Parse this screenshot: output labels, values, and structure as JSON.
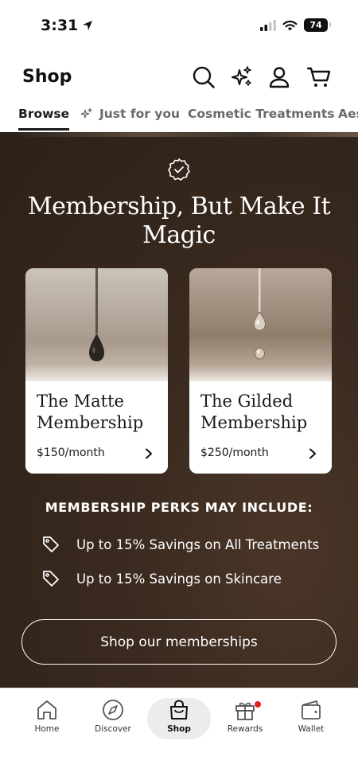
{
  "status_bar": {
    "time": "3:31",
    "battery": "74"
  },
  "header": {
    "title": "Shop",
    "icons": [
      "search-icon",
      "sparkles-icon",
      "profile-icon",
      "cart-icon"
    ]
  },
  "tabs": [
    {
      "label": "Browse",
      "active": true
    },
    {
      "label": "Just for you",
      "icon": "sparkle-icon"
    },
    {
      "label": "Cosmetic Treatments"
    },
    {
      "label": "Aes"
    }
  ],
  "hero": {
    "title": "Membership, But Make It Magic",
    "cards": [
      {
        "name": "The Matte Membership",
        "price": "$150/month"
      },
      {
        "name": "The Gilded Membership",
        "price": "$250/month"
      }
    ],
    "perks_title": "MEMBERSHIP PERKS MAY INCLUDE:",
    "perks": [
      "Up to 15% Savings on All Treatments",
      "Up to 15% Savings on Skincare"
    ],
    "cta_label": "Shop our memberships"
  },
  "bottom_nav": [
    {
      "label": "Home",
      "icon": "home-icon"
    },
    {
      "label": "Discover",
      "icon": "compass-icon"
    },
    {
      "label": "Shop",
      "icon": "shopping-bag-icon",
      "active": true
    },
    {
      "label": "Rewards",
      "icon": "gift-icon",
      "badge": true
    },
    {
      "label": "Wallet",
      "icon": "wallet-icon"
    }
  ],
  "colors": {
    "hero_bg": "#2d2118",
    "accent_badge": "#e0201e",
    "text_dark": "#111111"
  }
}
